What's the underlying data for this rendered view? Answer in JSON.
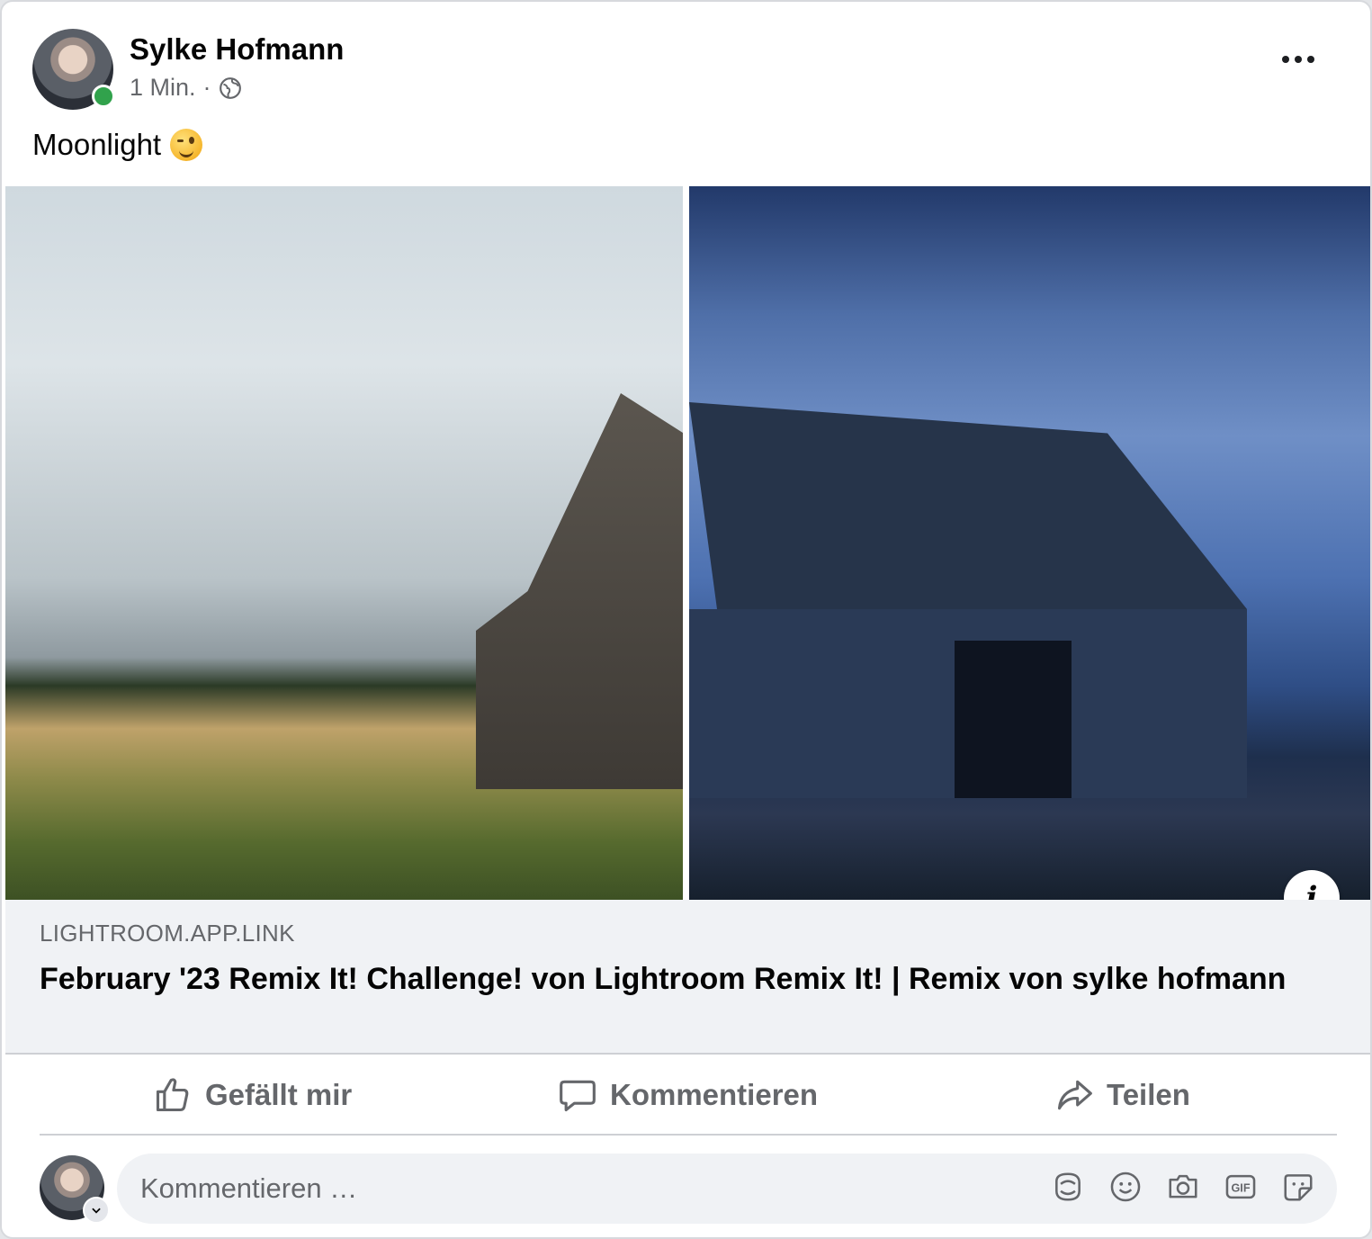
{
  "post": {
    "author": "Sylke Hofmann",
    "time": "1 Min.",
    "separator": "·",
    "privacy_icon": "globe-icon",
    "text": "Moonlight",
    "emoji": "winking-face-emoji",
    "menu_icon": "more-options-icon"
  },
  "link_preview": {
    "domain": "LIGHTROOM.APP.LINK",
    "title": "February '23 Remix It! Challenge! von Lightroom Remix It! | Remix von sylke hofmann",
    "info_icon": "info-icon"
  },
  "actions": {
    "like_label": "Gefällt mir",
    "comment_label": "Kommentieren",
    "share_label": "Teilen"
  },
  "comment_box": {
    "placeholder": "Kommentieren …",
    "icons": [
      "avatar-sticker-icon",
      "emoji-icon",
      "camera-icon",
      "gif-icon",
      "sticker-icon"
    ],
    "gif_text": "GIF"
  },
  "colors": {
    "online": "#31a24c",
    "secondary_text": "#65676b",
    "link_bg": "#f0f2f5"
  }
}
